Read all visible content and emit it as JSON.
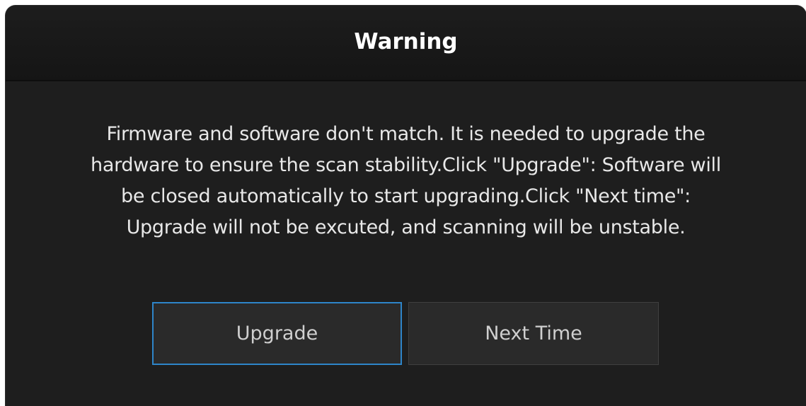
{
  "dialog": {
    "title": "Warning",
    "message": "Firmware and software don't match. It is needed to upgrade the\nhardware to ensure the scan stability.Click \"Upgrade\": Software will\nbe closed  automatically to start upgrading.Click \"Next time\":\nUpgrade will not be excuted, and scanning will be unstable.",
    "buttons": {
      "upgrade_label": "Upgrade",
      "next_label": "Next Time"
    },
    "colors": {
      "background": "#1e1e1e",
      "title_bar": "#171717",
      "focus_border": "#2e85c9",
      "text": "#e8e8e8"
    }
  }
}
